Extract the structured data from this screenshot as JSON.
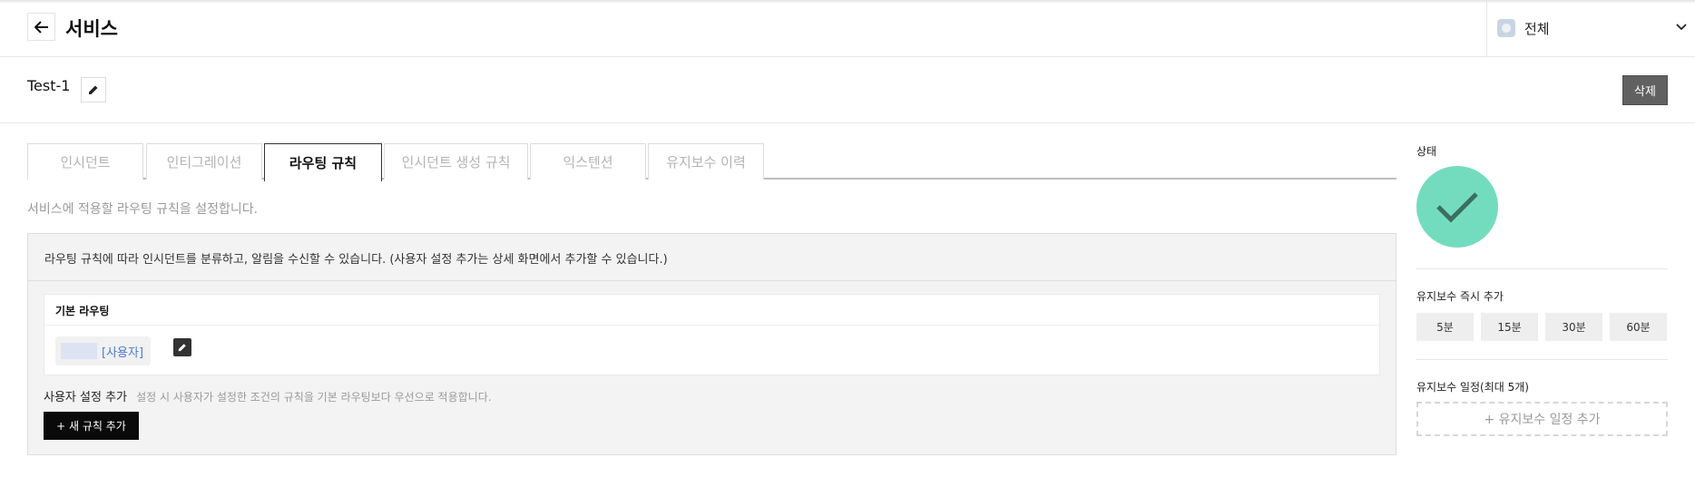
{
  "header": {
    "back_icon": "arrow-left-icon",
    "title": "서비스",
    "scope": {
      "label": "전체",
      "icon": "scope-icon"
    }
  },
  "service": {
    "name": "Test-1",
    "delete_label": "삭제"
  },
  "tabs": [
    {
      "label": "인시던트",
      "active": false
    },
    {
      "label": "인티그레이션",
      "active": false
    },
    {
      "label": "라우팅 규칙",
      "active": true
    },
    {
      "label": "인시던트 생성 규칙",
      "active": false
    },
    {
      "label": "익스텐션",
      "active": false
    },
    {
      "label": "유지보수 이력",
      "active": false
    }
  ],
  "routing": {
    "description": "서비스에 적용할 라우팅 규칙을 설정합니다.",
    "info": "라우팅 규칙에 따라 인시던트를 분류하고, 알림을 수신할 수 있습니다. (사용자 설정 추가는 상세 화면에서 추가할 수 있습니다.)",
    "basic_title": "기본 라우팅",
    "chip_label": "[사용자]",
    "custom_label": "사용자 설정 추가",
    "custom_desc": "설정 시 사용자가 설정한 조건의 규칙을 기본 라우팅보다 우선으로 적용합니다.",
    "add_rule_label": "+ 새 규칙 추가"
  },
  "sidebar": {
    "status_label": "상태",
    "status_color": "#73dcbf",
    "maintenance_now_label": "유지보수 즉시 추가",
    "maintenance_buttons": [
      "5분",
      "15분",
      "30분",
      "60분"
    ],
    "schedule_label": "유지보수 일정(최대 5개)",
    "add_schedule_label": "+ 유지보수 일정 추가"
  }
}
